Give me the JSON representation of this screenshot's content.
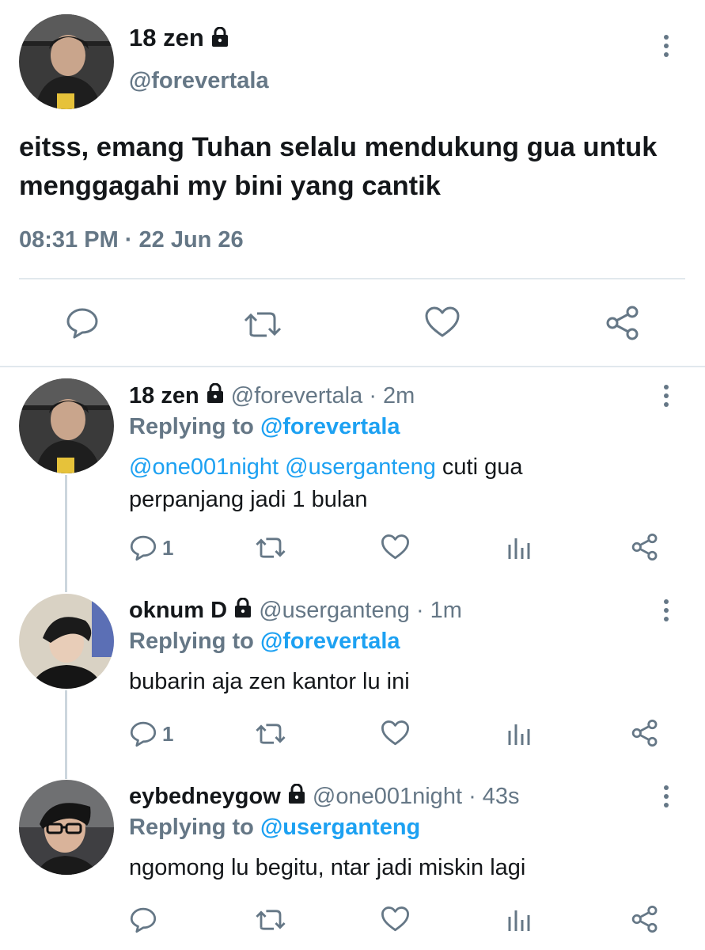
{
  "main_tweet": {
    "name": "18 zen",
    "handle": "@forevertala",
    "text": "eitss, emang Tuhan selalu mendukung gua untuk menggagahi my bini yang cantik",
    "timestamp": "08:31 PM · 22 Jun 26",
    "actions": [
      "reply-icon",
      "retweet-icon",
      "like-icon",
      "share-icon"
    ]
  },
  "replies": [
    {
      "name": "18 zen",
      "handle": "@forevertala",
      "age": "· 2m",
      "replying_prefix": "Replying to",
      "replying_to": "@forevertala",
      "mention1": "@one001night",
      "mention2": "@userganteng",
      "text": "cuti gua perpanjang jadi 1 bulan",
      "reply_count": "1"
    },
    {
      "name": "oknum D",
      "handle": "@userganteng",
      "age": "· 1m",
      "replying_prefix": "Replying to",
      "replying_to": "@forevertala",
      "text": "bubarin aja zen kantor lu ini",
      "reply_count": "1"
    },
    {
      "name": "eybedneygow",
      "handle": "@one001night",
      "age": "· 43s",
      "replying_prefix": "Replying to",
      "replying_to": "@userganteng",
      "text": "ngomong lu begitu, ntar jadi miskin lagi",
      "reply_count": ""
    }
  ],
  "colors": {
    "accent": "#1da1f2",
    "secondary_text": "#657786",
    "primary_text": "#14171a",
    "divider": "#e1e8ed"
  }
}
